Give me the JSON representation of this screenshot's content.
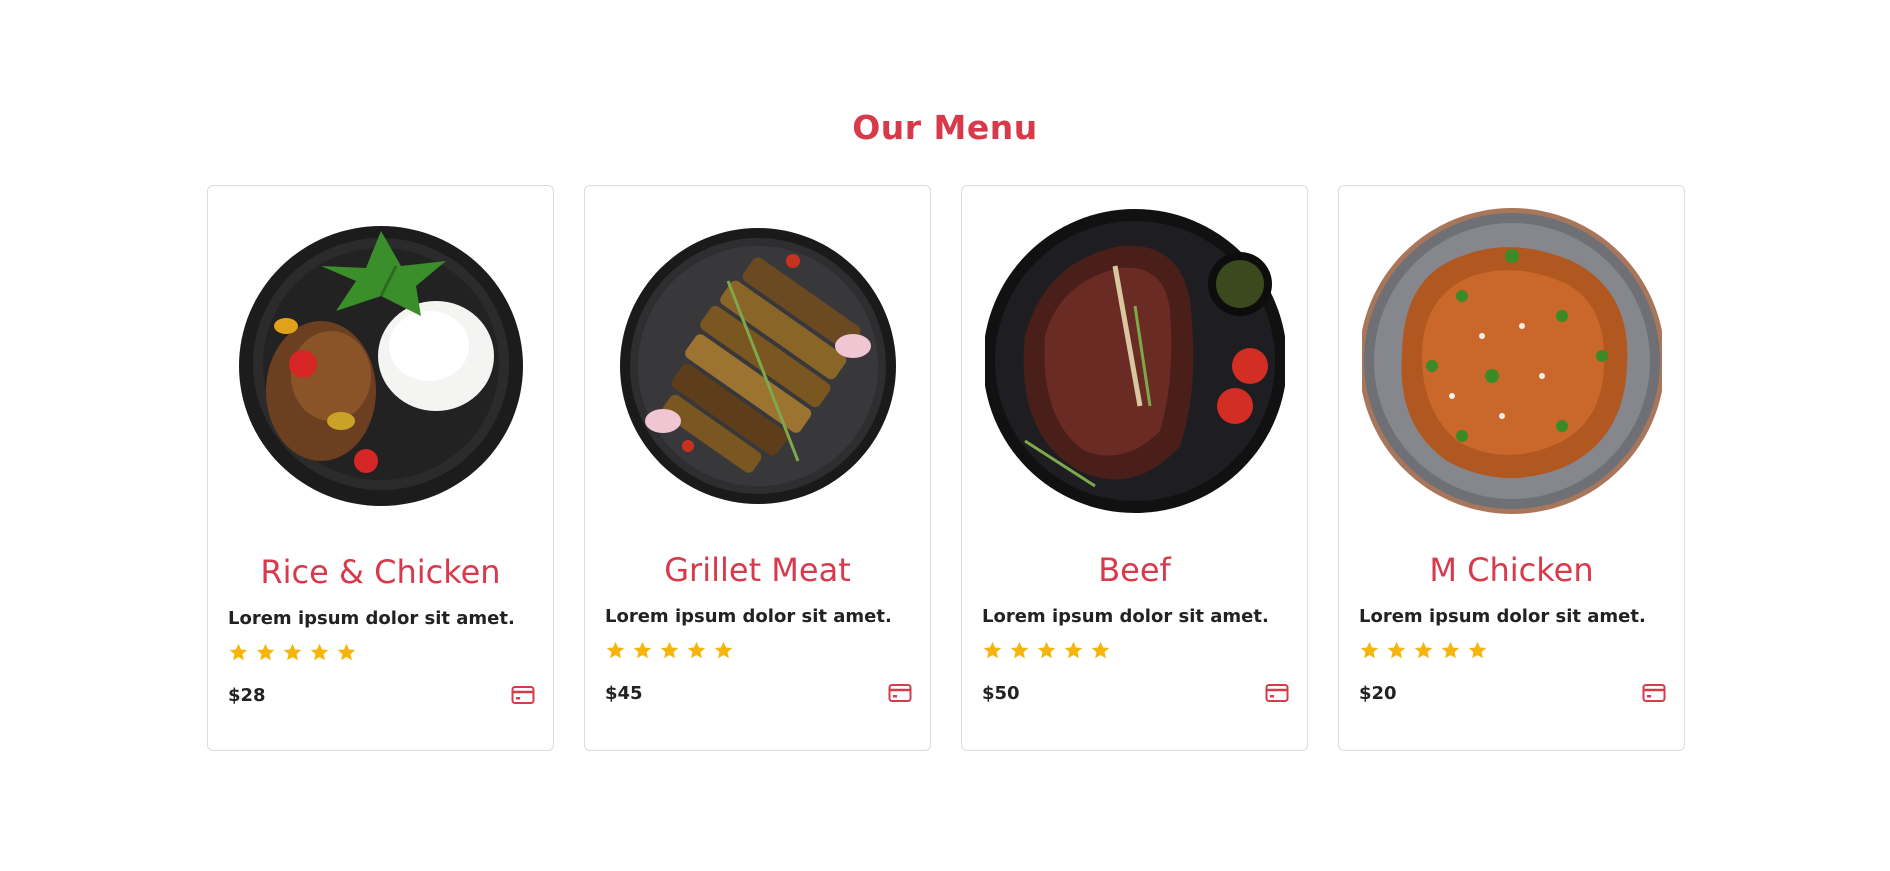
{
  "section": {
    "title": "Our Menu"
  },
  "colors": {
    "accent": "#d8394b",
    "star": "#f5b50a",
    "text": "#222222",
    "border": "#dcdcdc"
  },
  "menu_items": [
    {
      "name": "Rice & Chicken",
      "description": "Lorem ipsum dolor sit amet.",
      "rating": 5,
      "price": "$28",
      "image_icon": "rice-chicken-plate-image",
      "cart_icon": "credit-card-icon"
    },
    {
      "name": "Grillet Meat",
      "description": "Lorem ipsum dolor sit amet.",
      "rating": 5,
      "price": "$45",
      "image_icon": "grilled-meat-plate-image",
      "cart_icon": "credit-card-icon"
    },
    {
      "name": "Beef",
      "description": "Lorem ipsum dolor sit amet.",
      "rating": 5,
      "price": "$50",
      "image_icon": "beef-steak-plate-image",
      "cart_icon": "credit-card-icon"
    },
    {
      "name": "M Chicken",
      "description": "Lorem ipsum dolor sit amet.",
      "rating": 5,
      "price": "$20",
      "image_icon": "chicken-plate-image",
      "cart_icon": "credit-card-icon"
    }
  ]
}
